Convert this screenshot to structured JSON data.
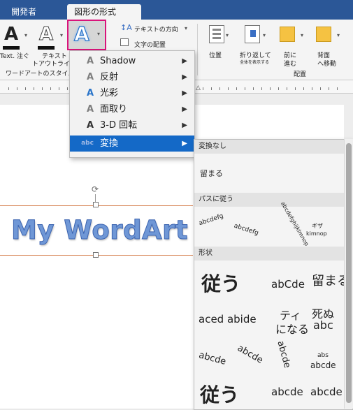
{
  "tabs": [
    "開発者",
    "図形の形式"
  ],
  "ribbon": {
    "text_fill_label": "Text",
    "text_fill_label2": "注ぐ",
    "outline_label1": "テキスト",
    "outline_label2": "トアウトライン",
    "group_wordart": "ワードアートのスタイル",
    "text_direction": "テキストの方向",
    "text_align": "文字の配置",
    "position": "位置",
    "wrap1": "折り返して",
    "wrap2": "全体を表示する",
    "forward1": "前に",
    "forward2": "進む",
    "backward1": "背面",
    "backward2": "へ移動",
    "group_arrange": "配置"
  },
  "menu": {
    "items": [
      {
        "icon": "A",
        "label": "Shadow"
      },
      {
        "icon": "A",
        "label": "反射"
      },
      {
        "icon": "A",
        "label": "光彩"
      },
      {
        "icon": "A",
        "label": "面取り"
      },
      {
        "icon": "A",
        "label": "3-D 回転"
      },
      {
        "icon": "abc",
        "label": "変換"
      }
    ]
  },
  "submenu": {
    "sec_none": "変換なし",
    "none_item": "留まる",
    "sec_path": "パスに従う",
    "path_items": [
      "abcdefg",
      "abcdefg",
      "abcdefghijklmnop",
      "ギザ",
      "kimnop"
    ],
    "sec_shape": "形状",
    "shape_row1": [
      "従う",
      "abCde",
      "留まる"
    ],
    "shape_row2": [
      "aced abide",
      "ティ",
      "になる",
      "死ぬ",
      "abc"
    ],
    "shape_row3": [
      "abcde",
      "abcde",
      "abcde",
      "abs",
      "abcde"
    ],
    "shape_row4": [
      "従う",
      "abcde",
      "abcde"
    ]
  },
  "document": {
    "wordart_text": "My WordArt"
  }
}
